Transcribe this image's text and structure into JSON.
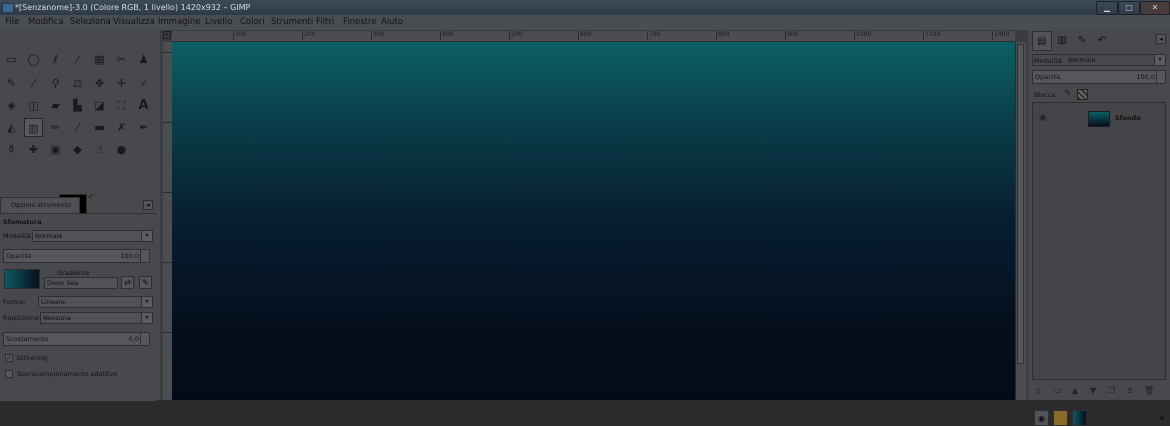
{
  "window": {
    "title": "*[Senzanome]-3.0 (Colore RGB, 1 livello) 1420x932 – GIMP"
  },
  "menu": [
    "File",
    "Modifica",
    "Seleziona",
    "Visualizza",
    "Immagine",
    "Livello",
    "Colori",
    "Strumenti",
    "Filtri",
    "Finestre",
    "Aiuto"
  ],
  "tool_options": {
    "tab_label": "Opzioni strumento",
    "tool_name": "Sfumatura",
    "mode_label": "Modalità",
    "mode_value": "Normale",
    "opacity_label": "Opacità",
    "opacity_value": "100,0",
    "gradient_label": "Gradiente",
    "gradient_value": "Deep Sea",
    "shape_label": "Forma:",
    "shape_value": "Lineare",
    "repeat_label": "Ripetizione",
    "repeat_value": "Nessuna",
    "offset_label": "Scostamento",
    "offset_value": "0,0",
    "dithering_label": "Dithering",
    "adaptive_label": "Sovracampionamento adattivo"
  },
  "ruler": {
    "h_ticks": [
      "100",
      "200",
      "300",
      "400",
      "500",
      "600",
      "700",
      "800",
      "900",
      "1000",
      "1100",
      "1200",
      "1300"
    ],
    "end_label": "1400"
  },
  "layers_panel": {
    "mode_label": "Modalità",
    "mode_value": "Normale",
    "opacity_label": "Opacità",
    "opacity_value": "100,0",
    "lock_label": "Blocca:",
    "layers": [
      {
        "name": "Sfondo"
      }
    ]
  },
  "colors": {
    "foreground": "#000000",
    "background": "#000000",
    "canvas_top": "#0c5f65",
    "canvas_bottom": "#040b18"
  }
}
